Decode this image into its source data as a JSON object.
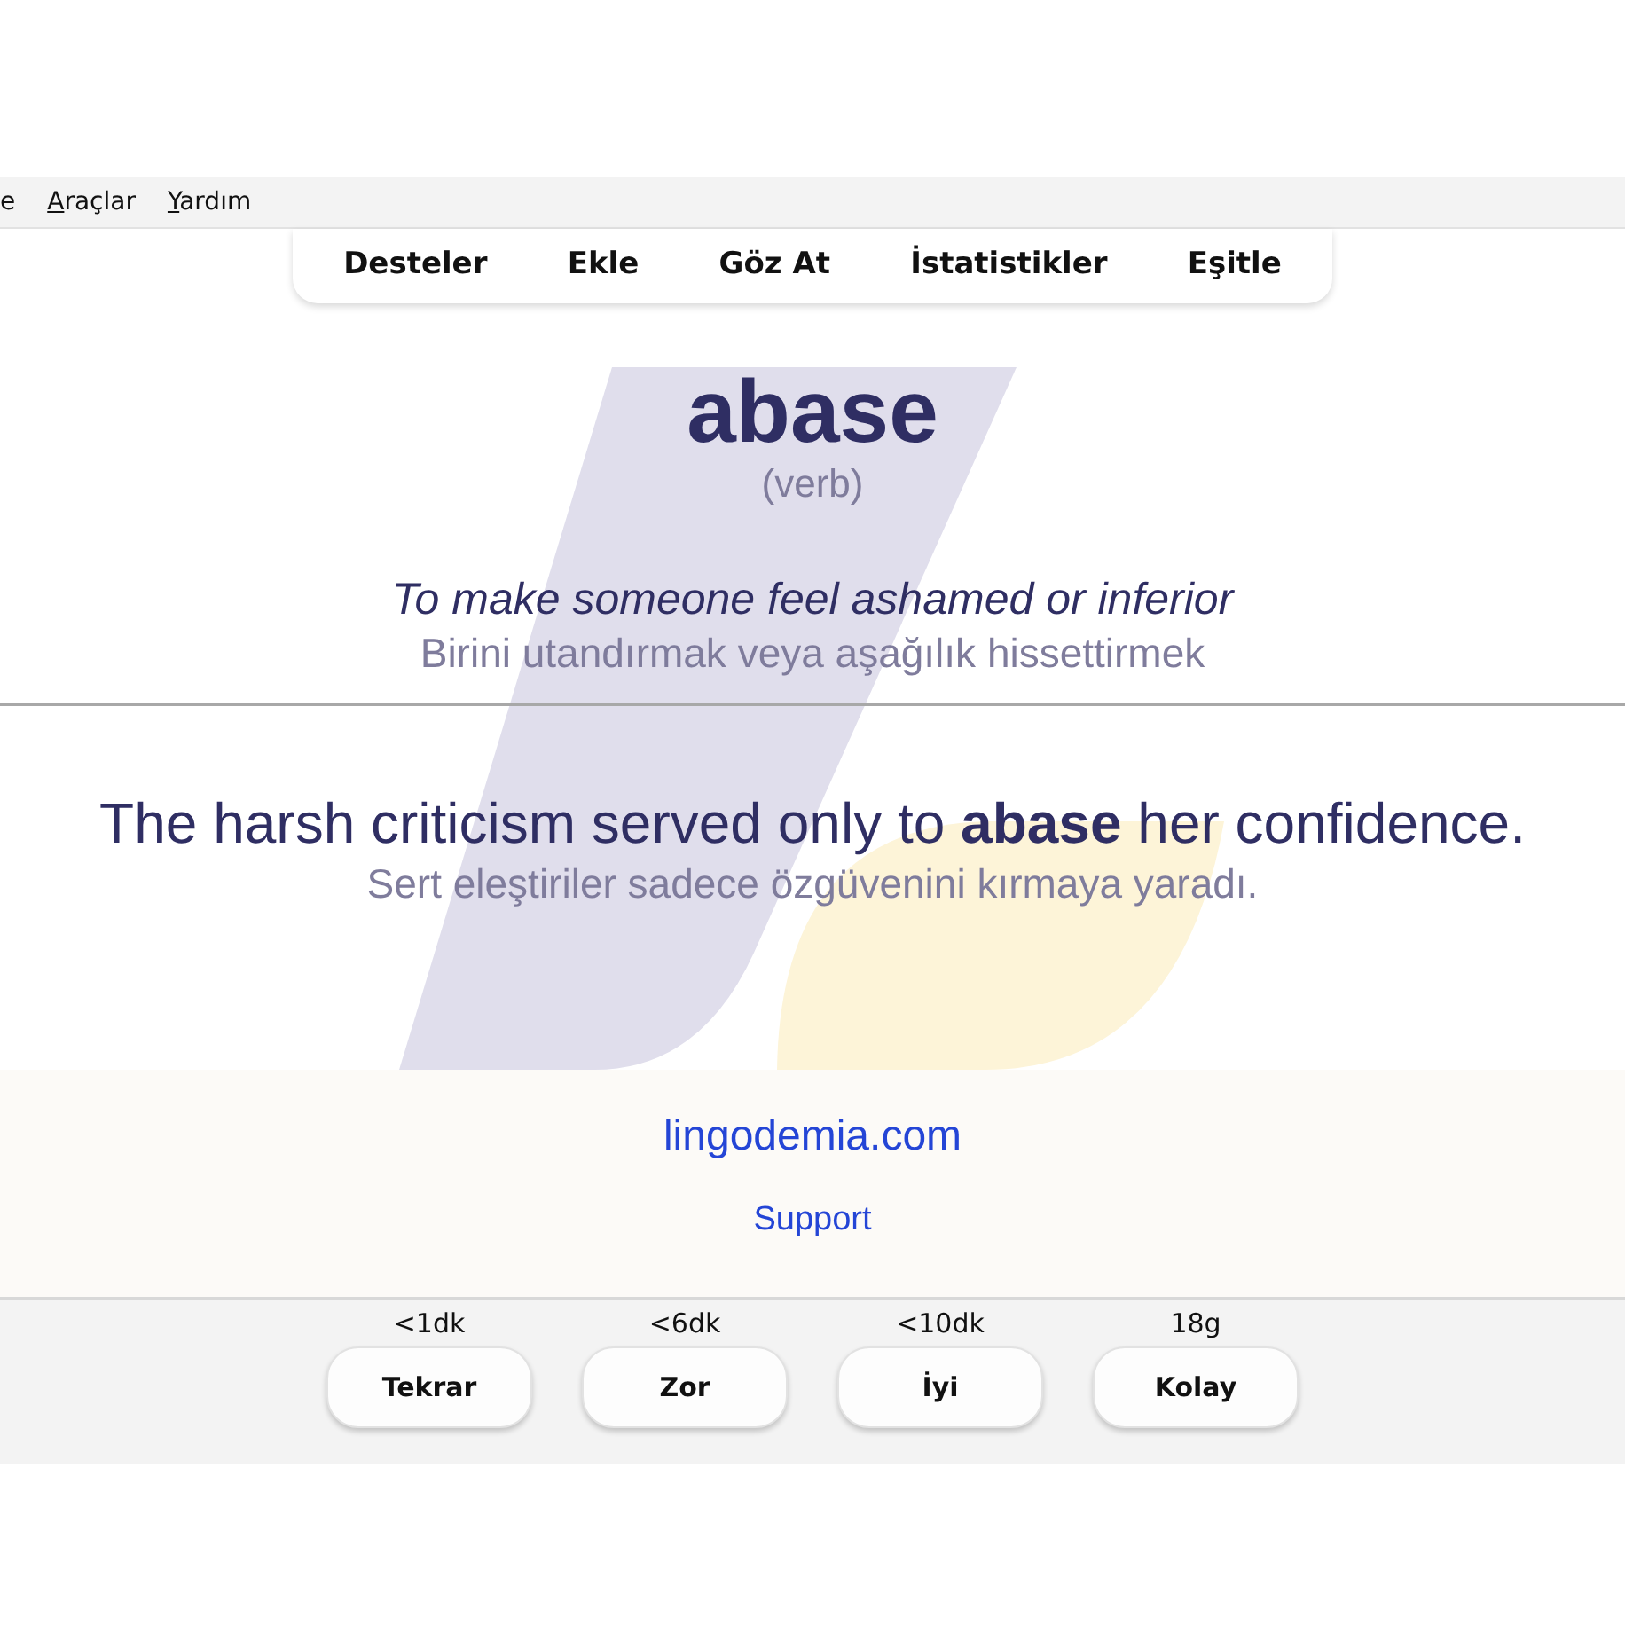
{
  "menu_bar": [
    {
      "label": "e",
      "access_key_underlined": false
    },
    {
      "label": "Araçlar",
      "access_key_underlined": true
    },
    {
      "label": "Yardım",
      "access_key_underlined": true
    }
  ],
  "toolbar": [
    {
      "label": "Desteler"
    },
    {
      "label": "Ekle"
    },
    {
      "label": "Göz At"
    },
    {
      "label": "İstatistikler"
    },
    {
      "label": "Eşitle"
    }
  ],
  "card": {
    "word": "abase",
    "part_of_speech": "(verb)",
    "definition": "To make someone feel ashamed or inferior",
    "definition_translation": "Birini utandırmak veya aşağılık hissettirmek",
    "example": "The harsh criticism served only to **abase** her confidence.",
    "example_translation": "Sert eleştiriler sadece özgüvenini kırmaya yaradı."
  },
  "footer": {
    "website": "lingodemia.com",
    "support": "Support"
  },
  "answer_buttons": [
    {
      "interval": "<1dk",
      "label": "Tekrar"
    },
    {
      "interval": "<6dk",
      "label": "Zor"
    },
    {
      "interval": "<10dk",
      "label": "İyi"
    },
    {
      "interval": "18g",
      "label": "Kolay"
    }
  ]
}
